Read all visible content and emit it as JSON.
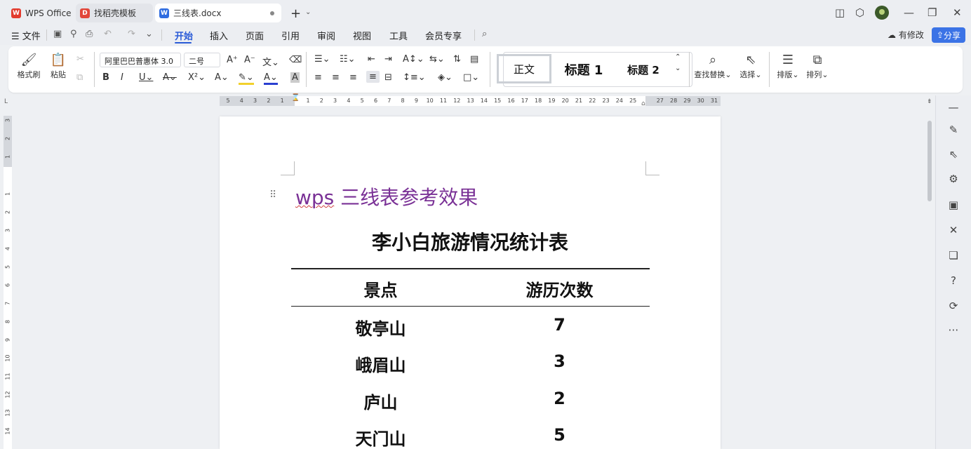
{
  "tabs": [
    {
      "label": "WPS Office",
      "logo": "W"
    },
    {
      "label": "找稻壳模板",
      "logo": "D"
    },
    {
      "label": "三线表.docx",
      "logo": "W"
    }
  ],
  "menu": {
    "file": "文件",
    "items": [
      "开始",
      "插入",
      "页面",
      "引用",
      "审阅",
      "视图",
      "工具",
      "会员专享"
    ],
    "modify": "有修改",
    "share": "分享"
  },
  "ribbon": {
    "format_painter": "格式刷",
    "paste": "粘贴",
    "font_name": "阿里巴巴普惠体 3.0",
    "font_size": "二号",
    "styles": [
      "正文",
      "标题 1",
      "标题 2"
    ],
    "find_replace": "查找替换",
    "select": "选择",
    "layout": "排版",
    "arrange": "排列"
  },
  "ruler": {
    "top_left": [
      "5",
      "4",
      "3",
      "2",
      "1"
    ],
    "top_right": [
      "1",
      "2",
      "3",
      "4",
      "5",
      "6",
      "7",
      "8",
      "9",
      "10",
      "11",
      "12",
      "13",
      "14",
      "15",
      "16",
      "17",
      "18",
      "19",
      "20",
      "21",
      "22",
      "23",
      "24",
      "25",
      "27",
      "28",
      "29",
      "30",
      "31"
    ],
    "left_top": [
      "3",
      "2",
      "1"
    ],
    "left_main": [
      "1",
      "2",
      "3",
      "4",
      "5",
      "6",
      "7",
      "8",
      "9",
      "10",
      "11",
      "12",
      "13",
      "14"
    ]
  },
  "document": {
    "heading_wavy": "wps",
    "heading_rest": " 三线表参考效果",
    "table_title": "李小白旅游情况统计表",
    "headers": [
      "景点",
      "游历次数"
    ],
    "rows": [
      [
        "敬亭山",
        "7"
      ],
      [
        "峨眉山",
        "3"
      ],
      [
        "庐山",
        "2"
      ],
      [
        "天门山",
        "5"
      ]
    ]
  },
  "colors": {
    "accent": "#2a5bd7",
    "heading": "#7a3196",
    "share_button": "#3b73e6"
  }
}
